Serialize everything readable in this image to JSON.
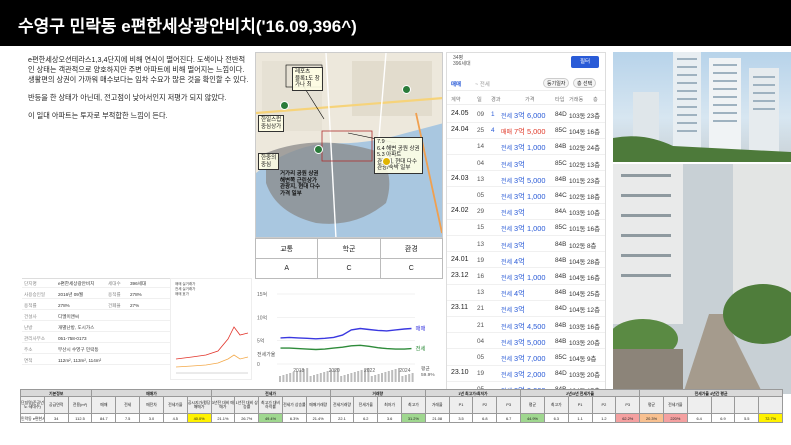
{
  "title": "수영구 민락동 e편한세상광안비치('16.09,396^)",
  "notes": [
    "e편한세상오션테라스1,3,4단지에 비해 연식이 떨어진다. 도색이나 전반적인 상태는 객관적으로 양호하지만 주변 아파트에 비해 떨어지는 느낌이다. 생활편의 상권이 가까워 매수보다는 임차 수요가 많은 것을 확인할 수 있다.",
    "반등을 한 상태가 아닌데, 전고점이 낮아서인지 저평가 되지 않았다.",
    "이 일대 아파트는 투자로 부적합한 느낌이 든다."
  ],
  "map": {
    "labels": {
      "a": "광안리\n중심상권",
      "b": "레포츠\n블록1도 창\n가나 최",
      "c": "한일스럽\n중심상가",
      "d": "광안리 관광\n초형",
      "e": "7.9\n6.4 해변 공원 상권\n5.3 아파트\n관광지, 현대 다수\n관광/숙박 일부",
      "f": "거가리 공원 상권\n해변쪽 근린상가\n관광지, 현대 다수\n가격 일부",
      "g": "한중의\n중심"
    },
    "score_tags": [
      "6.3",
      "6.5",
      "6.2",
      "6.1",
      "6.6",
      "6.1",
      "6.4",
      "6.4"
    ]
  },
  "rating": {
    "headers": [
      "교통",
      "학군",
      "환경"
    ],
    "grades": [
      "A",
      "C",
      "C"
    ]
  },
  "txn": {
    "header_line1": "34평",
    "header_line2": "396세대",
    "filter_label": "필터",
    "tab_active": "매매",
    "tab_other": "~ 전세",
    "btn1": "등기일자",
    "btn2": "층 선택",
    "cols": [
      "계약",
      "일",
      "경과",
      "가격",
      "타입",
      "거래동",
      "층"
    ],
    "rows": [
      {
        "date": "24.05",
        "day": "09",
        "cnt": "1",
        "type": "전세",
        "price": "3억 6,000",
        "kind": "rent",
        "size": "84D",
        "bld": "103동",
        "flr": "23층"
      },
      {
        "date": "24.04",
        "day": "25",
        "cnt": "4",
        "type": "매매",
        "price": "7억 5,000",
        "kind": "sale",
        "size": "85C",
        "bld": "104동",
        "flr": "16층"
      },
      {
        "date": "",
        "day": "14",
        "cnt": "",
        "type": "전세",
        "price": "3억 1,000",
        "kind": "rent",
        "size": "84B",
        "bld": "102동",
        "flr": "24층"
      },
      {
        "date": "",
        "day": "04",
        "cnt": "",
        "type": "전세",
        "price": "3억",
        "kind": "rent",
        "size": "85C",
        "bld": "102동",
        "flr": "13층"
      },
      {
        "date": "24.03",
        "day": "13",
        "cnt": "",
        "type": "전세",
        "price": "3억 5,000",
        "kind": "rent",
        "size": "84B",
        "bld": "101동",
        "flr": "23층"
      },
      {
        "date": "",
        "day": "05",
        "cnt": "",
        "type": "전세",
        "price": "3억 1,000",
        "kind": "rent",
        "size": "84C",
        "bld": "102동",
        "flr": "18층"
      },
      {
        "date": "24.02",
        "day": "29",
        "cnt": "",
        "type": "전세",
        "price": "3억",
        "kind": "rent",
        "size": "84A",
        "bld": "103동",
        "flr": "10층"
      },
      {
        "date": "",
        "day": "15",
        "cnt": "",
        "type": "전세",
        "price": "3억 1,000",
        "kind": "rent",
        "size": "85C",
        "bld": "101동",
        "flr": "16층"
      },
      {
        "date": "",
        "day": "13",
        "cnt": "",
        "type": "전세",
        "price": "3억",
        "kind": "rent",
        "size": "84B",
        "bld": "102동",
        "flr": "8층"
      },
      {
        "date": "24.01",
        "day": "19",
        "cnt": "",
        "type": "전세",
        "price": "4억",
        "kind": "rent",
        "size": "84B",
        "bld": "104동",
        "flr": "28층"
      },
      {
        "date": "23.12",
        "day": "16",
        "cnt": "",
        "type": "전세",
        "price": "3억 1,000",
        "kind": "rent",
        "size": "84B",
        "bld": "104동",
        "flr": "16층"
      },
      {
        "date": "",
        "day": "13",
        "cnt": "",
        "type": "전세",
        "price": "4억",
        "kind": "rent",
        "size": "84B",
        "bld": "104동",
        "flr": "25층"
      },
      {
        "date": "23.11",
        "day": "21",
        "cnt": "",
        "type": "전세",
        "price": "3억",
        "kind": "rent",
        "size": "84D",
        "bld": "104동",
        "flr": "12층"
      },
      {
        "date": "",
        "day": "21",
        "cnt": "",
        "type": "전세",
        "price": "3억 4,500",
        "kind": "rent",
        "size": "84B",
        "bld": "103동",
        "flr": "16층"
      },
      {
        "date": "",
        "day": "04",
        "cnt": "",
        "type": "전세",
        "price": "3억 5,000",
        "kind": "rent",
        "size": "84B",
        "bld": "103동",
        "flr": "20층"
      },
      {
        "date": "",
        "day": "05",
        "cnt": "",
        "type": "전세",
        "price": "3억 7,000",
        "kind": "rent",
        "size": "85C",
        "bld": "104동",
        "flr": "9층"
      },
      {
        "date": "23.10",
        "day": "19",
        "cnt": "",
        "type": "전세",
        "price": "3억 2,000",
        "kind": "rent",
        "size": "84D",
        "bld": "103동",
        "flr": "20층"
      },
      {
        "date": "",
        "day": "05",
        "cnt": "",
        "type": "전세",
        "price": "3억 9,000",
        "kind": "rent",
        "size": "84B",
        "bld": "104동",
        "flr": "17층"
      }
    ]
  },
  "info": {
    "rows": [
      {
        "k": "단지명",
        "v": "e편한세상광안비치",
        "k2": "세대수",
        "v2": "396세대"
      },
      {
        "k": "사용승인일",
        "v": "2016년 09월",
        "k2": "용적률",
        "v2": "278%"
      },
      {
        "k": "용적률",
        "v": "278%",
        "k2": "건폐율",
        "v2": "27%"
      },
      {
        "k": "건설사",
        "v": "디엘이앤씨",
        "k2": "",
        "v2": ""
      },
      {
        "k": "난방",
        "v": "개별난방, 도시가스",
        "k2": "",
        "v2": ""
      },
      {
        "k": "관리사무소",
        "v": "051-758-0173",
        "k2": "",
        "v2": ""
      },
      {
        "k": "주소",
        "v": "부산시 수영구 민락동 ",
        "k2": "",
        "v2": ""
      },
      {
        "k": "면적",
        "v": "112m², 113m², 114m²",
        "k2": "",
        "v2": ""
      }
    ]
  },
  "minichart": {
    "legend": [
      "매매 실거래가",
      "전세 실거래가",
      "매매 호가"
    ]
  },
  "chart_data": {
    "type": "line",
    "x": [
      2017,
      2017.5,
      2018,
      2018.5,
      2019,
      2019.5,
      2020,
      2020.5,
      2021,
      2021.5,
      2022,
      2022.5,
      2023,
      2023.5,
      2024,
      2024.4
    ],
    "series": [
      {
        "name": "매매",
        "values": [
          5.6,
          5.7,
          5.6,
          5.5,
          5.4,
          5.5,
          5.7,
          6.2,
          7.3,
          7.6,
          7.4,
          7.2,
          7.1,
          7.3,
          7.5,
          7.6
        ]
      },
      {
        "name": "전세",
        "values": [
          3.4,
          3.4,
          3.3,
          3.2,
          3.1,
          3.2,
          3.4,
          3.6,
          3.9,
          4.0,
          3.8,
          3.5,
          3.3,
          3.2,
          3.2,
          3.3
        ]
      }
    ],
    "yticks": [
      "15억",
      "10억",
      "5억",
      "0"
    ],
    "ylim": [
      0,
      15
    ],
    "xticks": [
      "2018",
      "2020",
      "2022",
      "2024"
    ],
    "annotation_left": "전세가율",
    "annotation_right": "평균\n59.9%",
    "colors": {
      "sale": "#3a38e0",
      "rent": "#2e8b3a",
      "bars": "#bcbcbc"
    }
  },
  "bottom_table": {
    "groups": [
      "기본정보",
      "매매가",
      "전세가",
      "거래량",
      "1년 최고가/최저가",
      "2년/3년 전세가율",
      "전세가율 4년간 평균"
    ],
    "headers": [
      "단지명(준공년도·세대수)",
      "공급면적",
      "전용(m²)",
      "매매",
      "전세",
      "매전차",
      "전세가율",
      "공시지가/평당매매가",
      "3년전 대비 매매가",
      "1년전 대비 상승률",
      "최고가 대비 하락률",
      "전세가 상승률",
      "매매거래량",
      "전세거래량",
      "전세가율",
      "최저가",
      "최고가",
      "거래율",
      "P1",
      "P2",
      "P3",
      "평균",
      "최고가",
      "P1",
      "P2",
      "P3",
      "평균",
      "전세가율"
    ],
    "row": [
      "민락동 e편한세상광안비치('16.09·396)",
      "34",
      "112.5",
      "84.7",
      "7.5",
      "3.0",
      "4.5",
      "40.0%",
      "21.1%",
      "26.7%",
      "49.4%",
      "6.3%",
      "21.4%",
      "22.1",
      "6.2",
      "3.6",
      "31.2%",
      "21.08",
      "3.5",
      "6.8",
      "6.7",
      "44.9%",
      "6.3",
      "1.1",
      "1.2",
      "62.2%",
      "20.3%",
      "220%",
      "6.4",
      "6.9",
      "5.5",
      "72.7%",
      "33.9%",
      "14%"
    ]
  }
}
